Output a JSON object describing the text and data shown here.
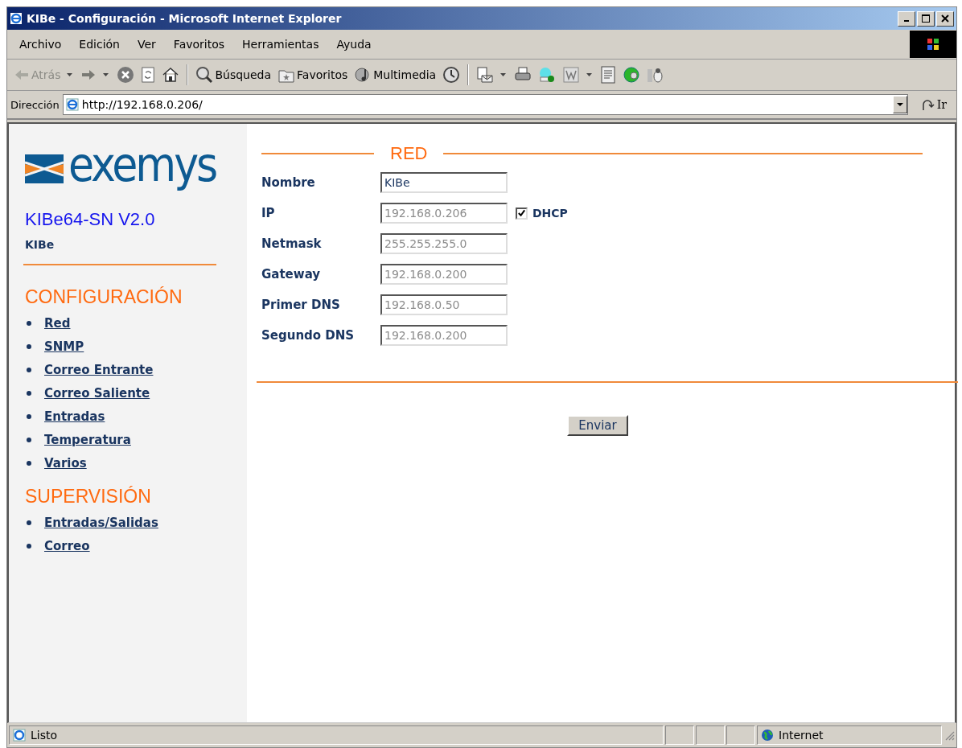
{
  "window": {
    "title": "KIBe - Configuración - Microsoft Internet Explorer"
  },
  "menu": [
    "Archivo",
    "Edición",
    "Ver",
    "Favoritos",
    "Herramientas",
    "Ayuda"
  ],
  "toolbar": [
    {
      "kind": "back",
      "label": "Atrás",
      "disabled": true
    },
    {
      "kind": "forward",
      "disabled": false
    },
    {
      "kind": "stop"
    },
    {
      "kind": "refresh"
    },
    {
      "kind": "home"
    },
    {
      "kind": "sep"
    },
    {
      "kind": "search",
      "label": "Búsqueda"
    },
    {
      "kind": "favorites",
      "label": "Favoritos"
    },
    {
      "kind": "media",
      "label": "Multimedia"
    },
    {
      "kind": "history"
    },
    {
      "kind": "sep"
    },
    {
      "kind": "mail"
    },
    {
      "kind": "print"
    },
    {
      "kind": "messenger"
    },
    {
      "kind": "word"
    },
    {
      "kind": "notes"
    },
    {
      "kind": "globe"
    },
    {
      "kind": "penguin"
    }
  ],
  "address": {
    "label": "Dirección",
    "value": "http://192.168.0.206/",
    "go": "Ir"
  },
  "sidebar": {
    "logo": "exemys",
    "product": "KIBe64-SN V2.0",
    "device": "KIBe",
    "sections": [
      {
        "title": "CONFIGURACIÓN",
        "links": [
          "Red",
          "SNMP",
          "Correo Entrante",
          "Correo Saliente",
          "Entradas",
          "Temperatura",
          "Varios"
        ]
      },
      {
        "title": "SUPERVISIÓN",
        "links": [
          "Entradas/Salidas",
          "Correo"
        ]
      }
    ]
  },
  "form": {
    "title": "RED",
    "fields": [
      {
        "label": "Nombre",
        "value": "KIBe",
        "disabled": false
      },
      {
        "label": "IP",
        "value": "192.168.0.206",
        "disabled": true,
        "checkbox": {
          "label": "DHCP",
          "checked": true
        }
      },
      {
        "label": "Netmask",
        "value": "255.255.255.0",
        "disabled": true
      },
      {
        "label": "Gateway",
        "value": "192.168.0.200",
        "disabled": true
      },
      {
        "label": "Primer DNS",
        "value": "192.168.0.50",
        "disabled": true
      },
      {
        "label": "Segundo DNS",
        "value": "192.168.0.200",
        "disabled": true
      }
    ],
    "submit": "Enviar"
  },
  "status_bar": {
    "text": "Listo",
    "zone": "Internet"
  }
}
